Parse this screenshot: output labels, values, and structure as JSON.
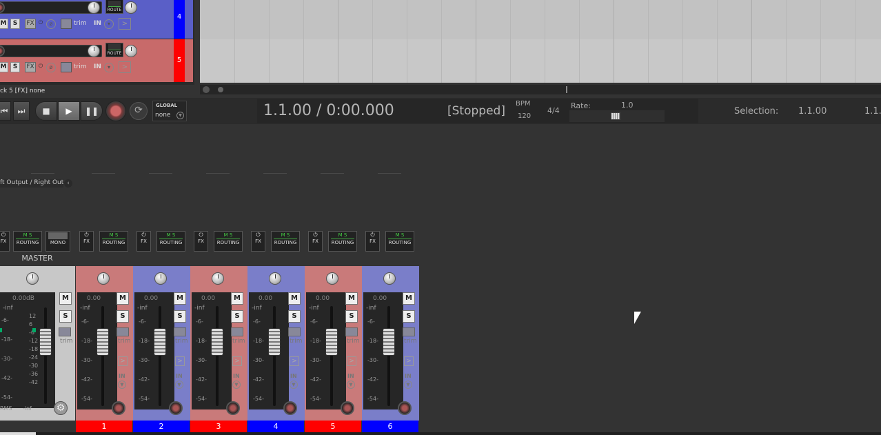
{
  "tracks": [
    {
      "num": "4",
      "color": "#5a5fc7",
      "numcolor": "#0000ff"
    },
    {
      "num": "5",
      "color": "#c86a6a",
      "numcolor": "#ff0000"
    }
  ],
  "track_controls": {
    "mute": "M",
    "solo": "S",
    "fx": "FX",
    "route": "ROUTE",
    "trim": "trim",
    "input": "IN"
  },
  "status_text": "ck 5 [FX] none",
  "transport": {
    "global_label": "GLOBAL",
    "global_value": "none",
    "position": "1.1.00 / 0:00.000",
    "state": "[Stopped]",
    "bpm_label": "BPM",
    "bpm_value": "120",
    "time_sig": "4/4",
    "rate_label": "Rate:",
    "rate_value": "1.0",
    "selection_label": "Selection:",
    "selection_start": "1.1.00",
    "selection_end": "1.1."
  },
  "io_label": "ft Output / Right Outp",
  "mixer_controls": {
    "fx": "FX",
    "routing": "ROUTING",
    "mono": "MONO"
  },
  "master": {
    "label": "MASTER",
    "db": "0.00dB",
    "inf": "-inf",
    "scale_left": [
      "-6-",
      "-18-",
      "-30-",
      "-42-",
      "-54-"
    ],
    "scale_right": [
      "12",
      "6",
      "-6",
      "-12",
      "-18",
      "-24",
      "-30",
      "-36",
      "-42"
    ],
    "rms": "RMS",
    "rms_val": "-inf"
  },
  "channels": [
    {
      "num": "1",
      "color": "#c97a7a",
      "numcolor": "#ff0000",
      "db": "0.00",
      "inf": "-inf"
    },
    {
      "num": "2",
      "color": "#7a7ec9",
      "numcolor": "#0000ff",
      "db": "0.00",
      "inf": "-inf"
    },
    {
      "num": "3",
      "color": "#c97a7a",
      "numcolor": "#ff0000",
      "db": "0.00",
      "inf": "-inf"
    },
    {
      "num": "4",
      "color": "#7a7ec9",
      "numcolor": "#0000ff",
      "db": "0.00",
      "inf": "-inf"
    },
    {
      "num": "5",
      "color": "#c97a7a",
      "numcolor": "#ff0000",
      "db": "0.00",
      "inf": "-inf"
    },
    {
      "num": "6",
      "color": "#7a7ec9",
      "numcolor": "#0000ff",
      "db": "0.00",
      "inf": "-inf"
    }
  ],
  "scale": [
    "-6-",
    "-18-",
    "-30-",
    "-42-",
    "-54-"
  ],
  "strip_labels": {
    "mute": "M",
    "solo": "S",
    "trim": "trim",
    "input": "IN"
  }
}
